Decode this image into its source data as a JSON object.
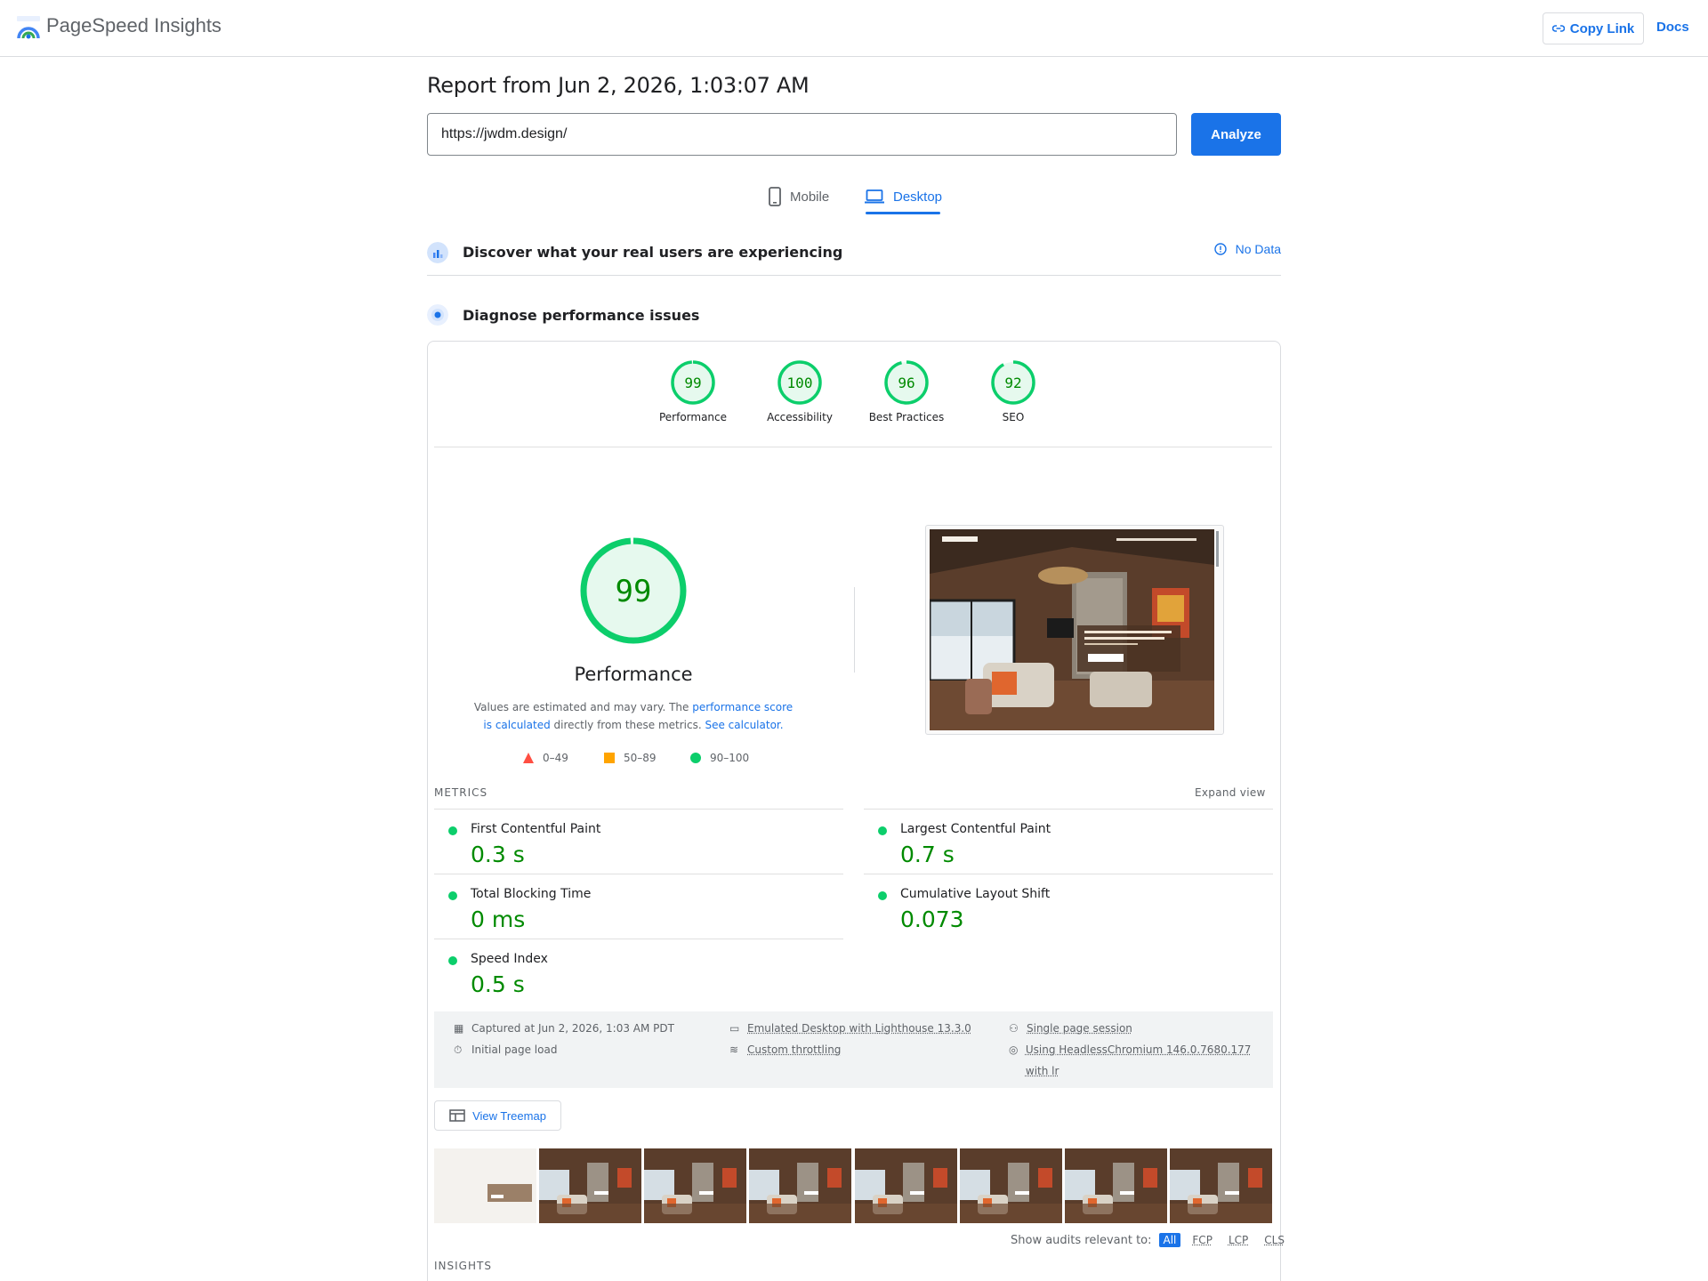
{
  "header": {
    "app_title": "PageSpeed Insights",
    "copy_link": "Copy Link",
    "docs": "Docs"
  },
  "report": {
    "title": "Report from Jun 2, 2026, 1:03:07 AM",
    "url_value": "https://jwdm.design/",
    "analyze_label": "Analyze"
  },
  "tabs": [
    {
      "label": "Mobile",
      "icon": "phone-icon",
      "selected": false
    },
    {
      "label": "Desktop",
      "icon": "laptop-icon",
      "selected": true
    }
  ],
  "crux": {
    "title": "Discover what your real users are experiencing",
    "status": "No Data"
  },
  "diagnose": {
    "title": "Diagnose performance issues"
  },
  "categories": [
    {
      "label": "Performance",
      "score": "99",
      "score_fraction": 0.99
    },
    {
      "label": "Accessibility",
      "score": "100",
      "score_fraction": 1.0
    },
    {
      "label": "Best Practices",
      "score": "96",
      "score_fraction": 0.96
    },
    {
      "label": "SEO",
      "score": "92",
      "score_fraction": 0.92
    }
  ],
  "performance": {
    "score": "99",
    "score_fraction": 0.99,
    "title": "Performance",
    "desc_pre": "Values are estimated and may vary. The ",
    "desc_link1": "performance score is calculated",
    "desc_mid": " directly from these metrics. ",
    "desc_link2": "See calculator.",
    "legend": [
      {
        "range": "0–49",
        "shape": "triangle",
        "color": "#ff4e42"
      },
      {
        "range": "50–89",
        "shape": "square",
        "color": "#ffa400"
      },
      {
        "range": "90–100",
        "shape": "circle",
        "color": "#0cce6b"
      }
    ]
  },
  "metrics": {
    "heading": "METRICS",
    "expand_label": "Expand view",
    "items": [
      {
        "name": "First Contentful Paint",
        "value": "0.3 s"
      },
      {
        "name": "Largest Contentful Paint",
        "value": "0.7 s"
      },
      {
        "name": "Total Blocking Time",
        "value": "0 ms"
      },
      {
        "name": "Cumulative Layout Shift",
        "value": "0.073"
      },
      {
        "name": "Speed Index",
        "value": "0.5 s"
      }
    ]
  },
  "runtime": {
    "captured": "Captured at Jun 2, 2026, 1:03 AM PDT",
    "initial_load": "Initial page load",
    "emulated": "Emulated Desktop with Lighthouse 13.3.0",
    "throttling": "Custom throttling",
    "session": "Single page session",
    "browser": "Using HeadlessChromium 146.0.7680.177 with lr"
  },
  "treemap_label": "View Treemap",
  "audits_filter": {
    "label": "Show audits relevant to:",
    "chips": [
      "All",
      "FCP",
      "LCP",
      "CLS"
    ]
  },
  "insights_heading": "INSIGHTS",
  "colors": {
    "accent": "#1a73e8",
    "pass": "#0cce6b",
    "pass_text": "#008a00"
  }
}
